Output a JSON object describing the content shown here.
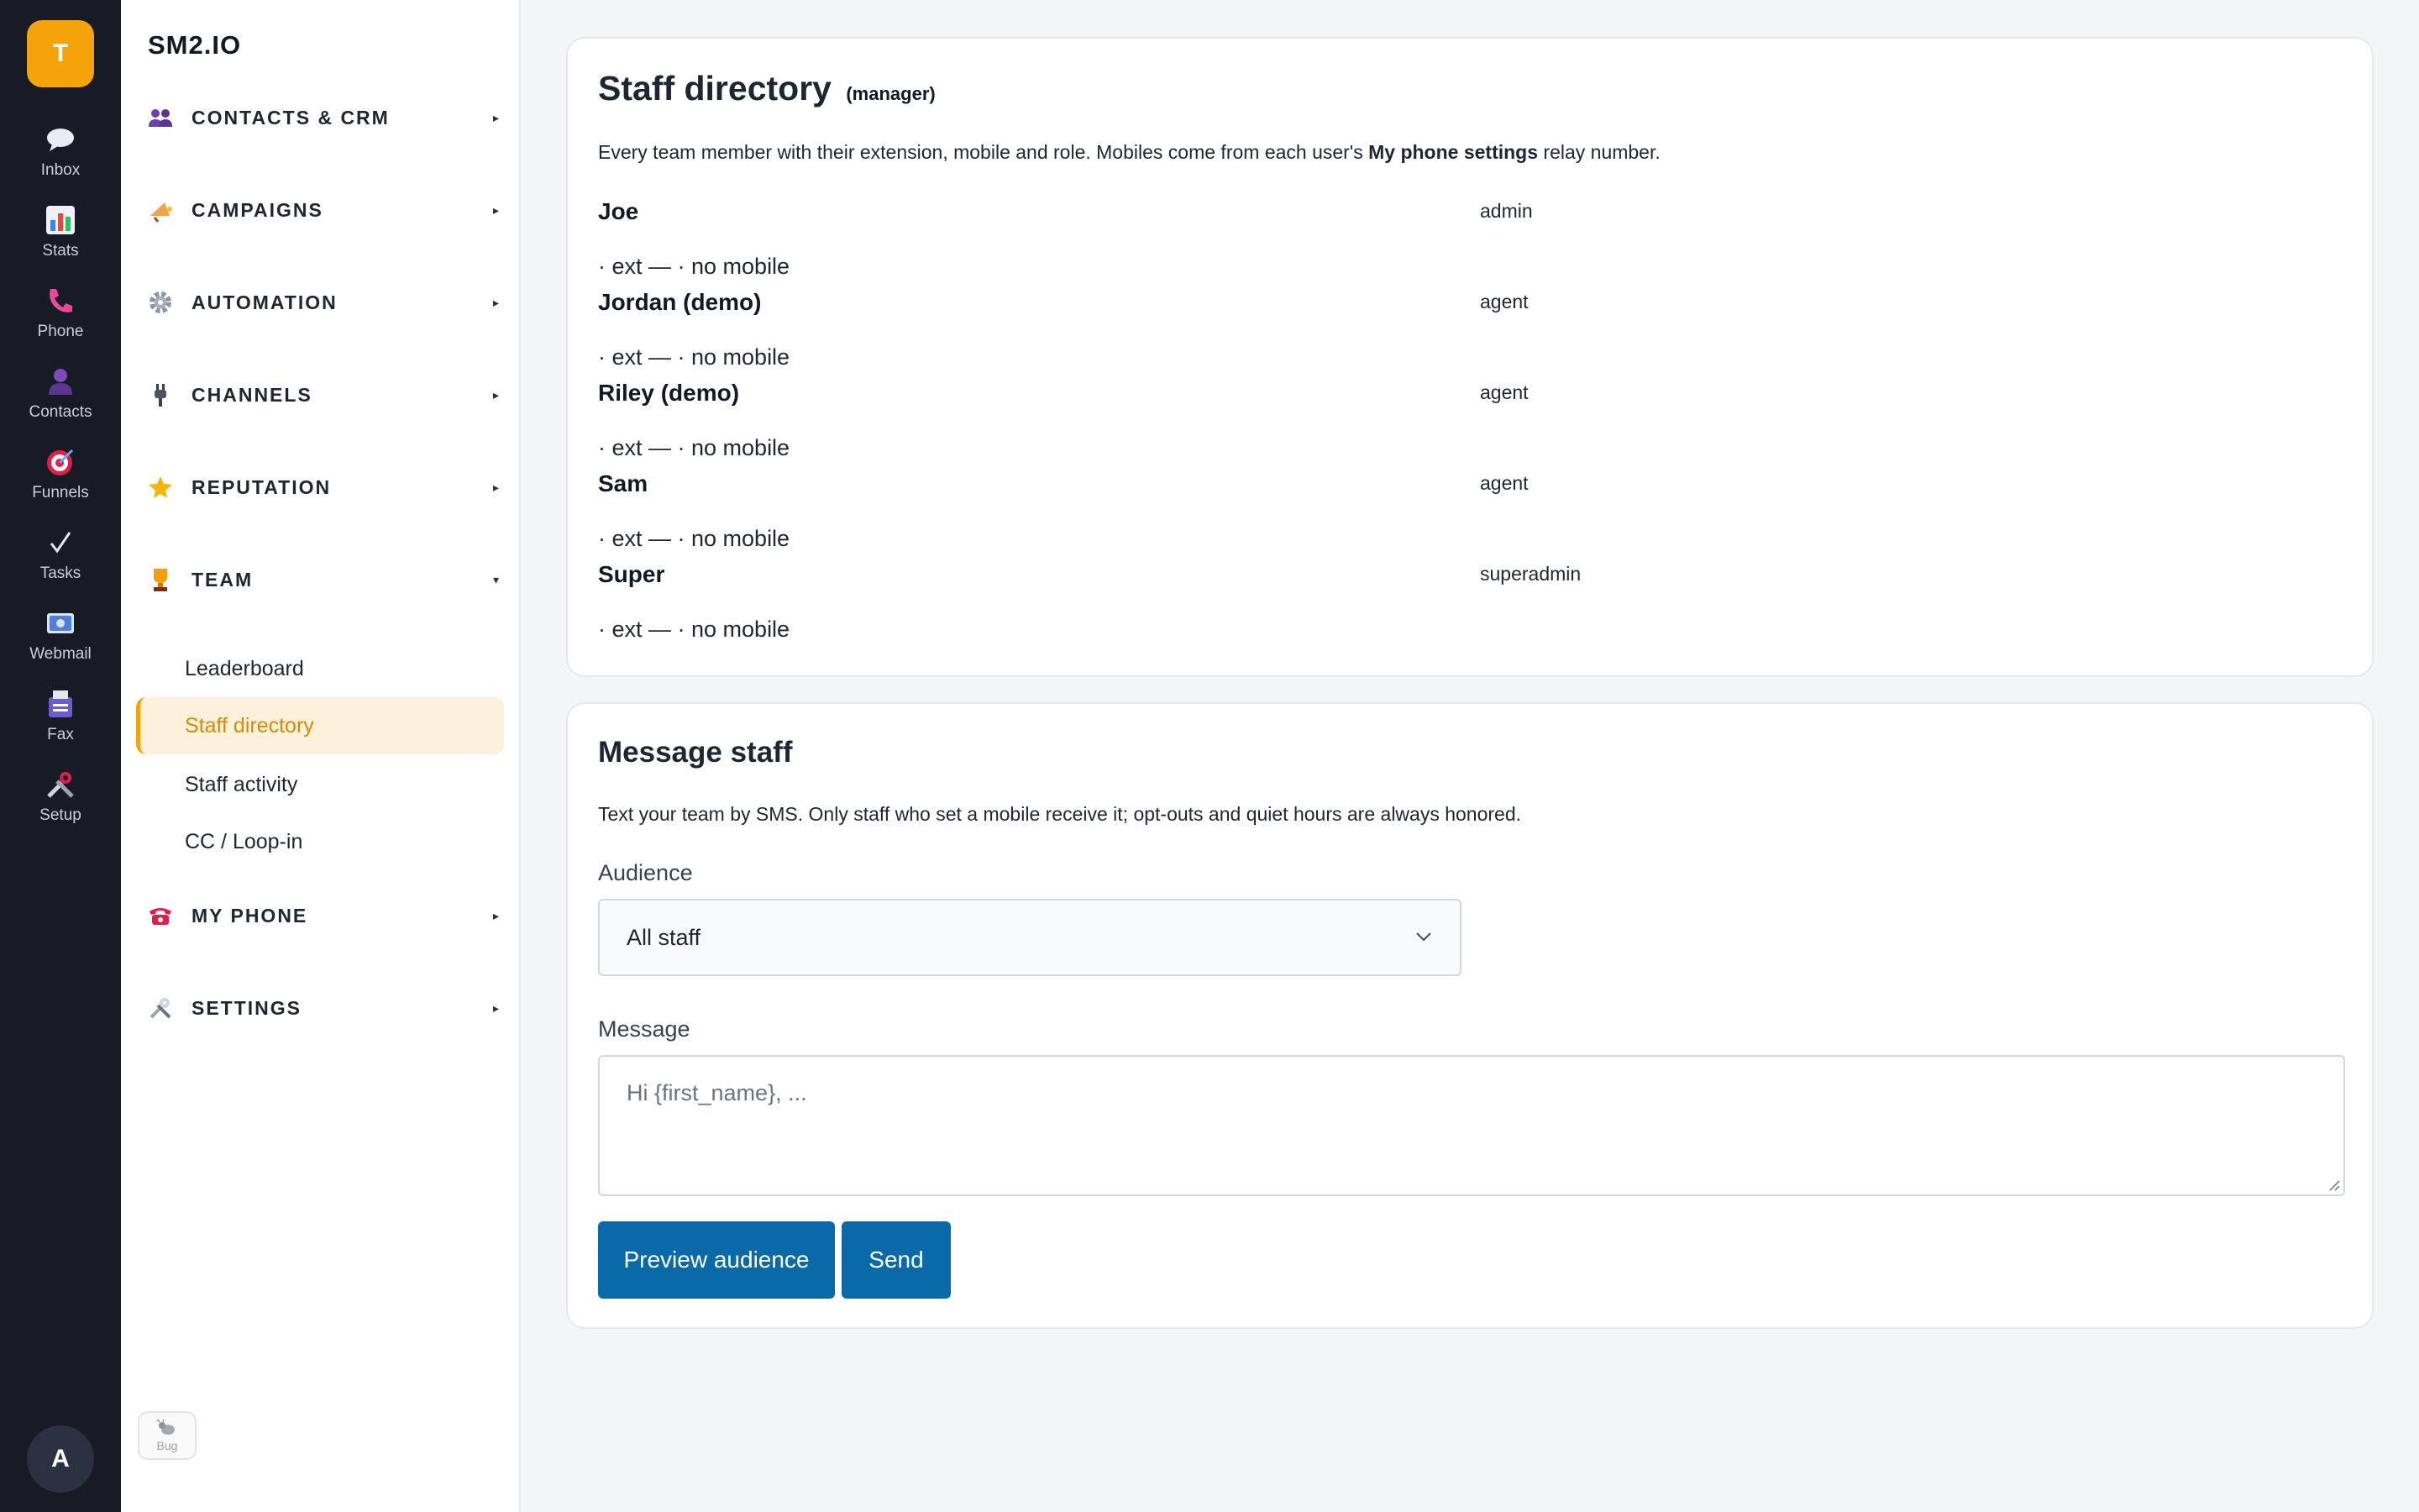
{
  "rail": {
    "logo_letter": "T",
    "items": [
      {
        "label": "Inbox",
        "icon": "speech-bubble-icon"
      },
      {
        "label": "Stats",
        "icon": "bar-chart-icon"
      },
      {
        "label": "Phone",
        "icon": "phone-icon"
      },
      {
        "label": "Contacts",
        "icon": "person-icon"
      },
      {
        "label": "Funnels",
        "icon": "target-icon"
      },
      {
        "label": "Tasks",
        "icon": "checkmark-icon"
      },
      {
        "label": "Webmail",
        "icon": "email-icon"
      },
      {
        "label": "Fax",
        "icon": "fax-icon"
      },
      {
        "label": "Setup",
        "icon": "tools-icon"
      }
    ],
    "avatar_letter": "A"
  },
  "nav": {
    "brand": "SM2.IO",
    "sections": [
      {
        "label": "CONTACTS & CRM",
        "icon": "people-icon",
        "expanded": false
      },
      {
        "label": "CAMPAIGNS",
        "icon": "megaphone-icon",
        "expanded": false
      },
      {
        "label": "AUTOMATION",
        "icon": "gear-icon",
        "expanded": false
      },
      {
        "label": "CHANNELS",
        "icon": "plug-icon",
        "expanded": false
      },
      {
        "label": "REPUTATION",
        "icon": "star-icon",
        "expanded": false
      },
      {
        "label": "TEAM",
        "icon": "trophy-icon",
        "expanded": true
      },
      {
        "label": "MY PHONE",
        "icon": "telephone-icon",
        "expanded": false
      },
      {
        "label": "SETTINGS",
        "icon": "wrench-icon",
        "expanded": false
      }
    ],
    "team_items": [
      {
        "label": "Leaderboard",
        "active": false
      },
      {
        "label": "Staff directory",
        "active": true
      },
      {
        "label": "Staff activity",
        "active": false
      },
      {
        "label": "CC / Loop-in",
        "active": false
      }
    ],
    "bug_label": "Bug"
  },
  "directory": {
    "title": "Staff directory",
    "badge": "(manager)",
    "desc_prefix": "Every team member with their extension, mobile and role. Mobiles come from each user's ",
    "desc_bold": "My phone settings",
    "desc_suffix": " relay number.",
    "staff": [
      {
        "name": "Joe",
        "meta": "· ext — · no mobile",
        "role": "admin"
      },
      {
        "name": "Jordan (demo)",
        "meta": "· ext — · no mobile",
        "role": "agent"
      },
      {
        "name": "Riley (demo)",
        "meta": "· ext — · no mobile",
        "role": "agent"
      },
      {
        "name": "Sam",
        "meta": "· ext — · no mobile",
        "role": "agent"
      },
      {
        "name": "Super",
        "meta": "· ext — · no mobile",
        "role": "superadmin"
      }
    ]
  },
  "message": {
    "title": "Message staff",
    "desc": "Text your team by SMS. Only staff who set a mobile receive it; opt-outs and quiet hours are always honored.",
    "audience_label": "Audience",
    "audience_value": "All staff",
    "message_label": "Message",
    "message_placeholder": "Hi {first_name}, ...",
    "preview_button": "Preview audience",
    "send_button": "Send"
  },
  "colors": {
    "accent": "#f5a30b",
    "primary_button": "#0a6aa8",
    "rail_bg": "#161b26"
  }
}
